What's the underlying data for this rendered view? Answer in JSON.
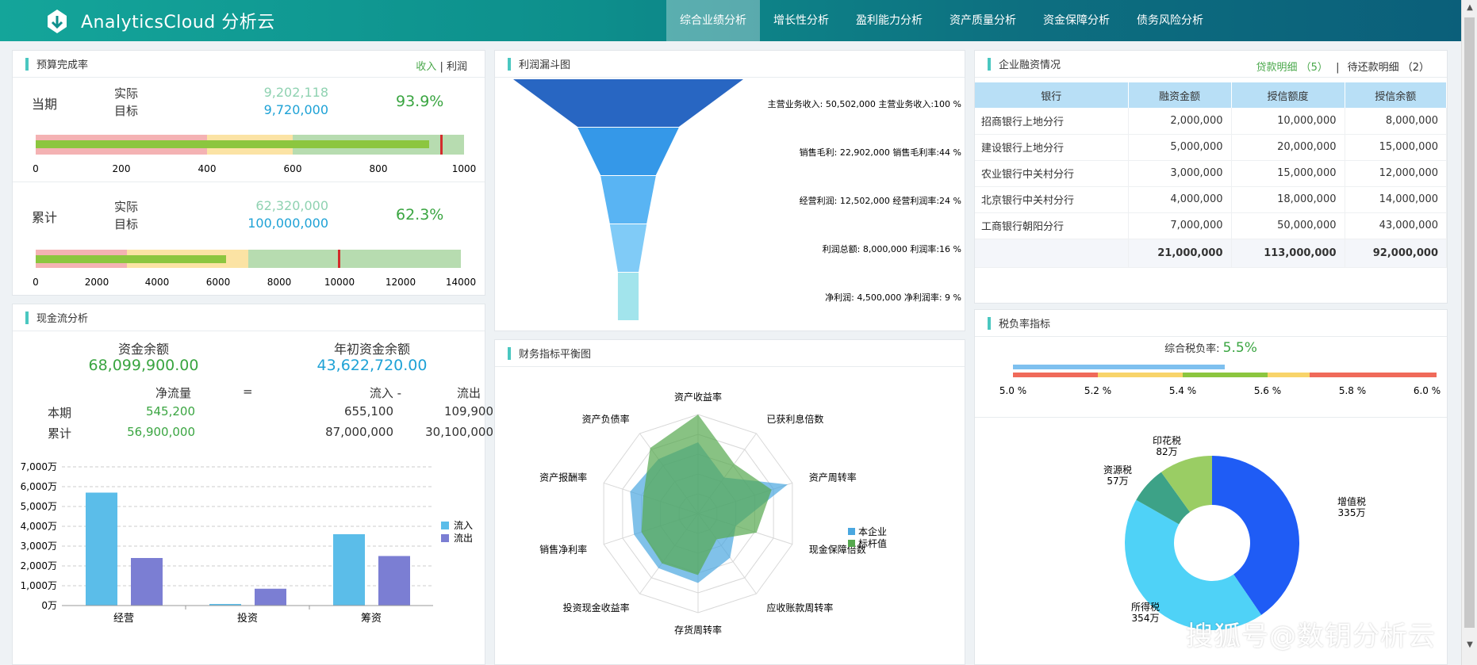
{
  "header": {
    "brand": "AnalyticsCloud 分析云",
    "nav": [
      "综合业绩分析",
      "增长性分析",
      "盈利能力分析",
      "资产质量分析",
      "资金保障分析",
      "债务风险分析"
    ]
  },
  "budget": {
    "title": "预算完成率",
    "toggle": {
      "income": "收入",
      "sep": "|",
      "profit": "利润"
    },
    "current": {
      "label": "当期",
      "actual_label": "实际",
      "target_label": "目标",
      "actual": "9,202,118",
      "target": "9,720,000",
      "rate": "93.9%",
      "ticks": [
        "0",
        "200",
        "400",
        "600",
        "800",
        "1000"
      ]
    },
    "cumulative": {
      "label": "累计",
      "actual_label": "实际",
      "target_label": "目标",
      "actual": "62,320,000",
      "target": "100,000,000",
      "rate": "62.3%",
      "ticks": [
        "0",
        "2000",
        "4000",
        "6000",
        "8000",
        "10000",
        "12000",
        "14000"
      ]
    }
  },
  "cashflow": {
    "title": "现金流分析",
    "balance_label": "资金余额",
    "balance": "68,099,900.00",
    "opening_label": "年初资金余额",
    "opening": "43,622,720.00",
    "col_net": "净流量",
    "eq": "=",
    "col_in": "流入 -",
    "col_out": "流出",
    "rows": [
      {
        "label": "本期",
        "net": "545,200",
        "in": "655,100",
        "out": "109,900"
      },
      {
        "label": "累计",
        "net": "56,900,000",
        "in": "87,000,000",
        "out": "30,100,000"
      }
    ],
    "chart_data": {
      "type": "bar",
      "categories": [
        "经营",
        "投资",
        "筹资"
      ],
      "series": [
        {
          "name": "流入",
          "values": [
            5700,
            80,
            3600
          ],
          "color": "#5bbde9"
        },
        {
          "name": "流出",
          "values": [
            2400,
            850,
            2500
          ],
          "color": "#7b7ed3"
        }
      ],
      "yticks": [
        "0万",
        "1,000万",
        "2,000万",
        "3,000万",
        "4,000万",
        "5,000万",
        "6,000万",
        "7,000万"
      ],
      "ylim": [
        0,
        7000
      ]
    }
  },
  "funnel": {
    "title": "利润漏斗图",
    "chart_data": {
      "type": "funnel",
      "stages": [
        {
          "label": "主营业务收入: 50,502,000 主营业务收入:100 %",
          "value": 100,
          "color": "#2866c2"
        },
        {
          "label": "销售毛利: 22,902,000 销售毛利率:44 %",
          "value": 44,
          "color": "#3598e8"
        },
        {
          "label": "经营利润: 12,502,000 经营利润率:24 %",
          "value": 24,
          "color": "#59b4f3"
        },
        {
          "label": "利润总额: 8,000,000 利润率:16 %",
          "value": 16,
          "color": "#80cbf7"
        },
        {
          "label": "净利润: 4,500,000 净利润率: 9 %",
          "value": 9,
          "color": "#a2e4ec"
        }
      ]
    }
  },
  "radar": {
    "title": "财务指标平衡图",
    "chart_data": {
      "type": "radar",
      "axes": [
        "资产收益率",
        "已获利息倍数",
        "资产周转率",
        "现金保障倍数",
        "应收账款周转率",
        "存货周转率",
        "投资现金收益率",
        "销售净利率",
        "资产报酬率",
        "资产负债率"
      ],
      "series": [
        {
          "name": "本企业",
          "values": [
            0.72,
            0.45,
            0.95,
            0.4,
            0.55,
            0.7,
            0.68,
            0.68,
            0.72,
            0.68
          ],
          "color": "#4aa7e0"
        },
        {
          "name": "标杆值",
          "values": [
            1.0,
            0.62,
            0.78,
            0.62,
            0.32,
            0.62,
            0.62,
            0.6,
            0.58,
            0.82
          ],
          "color": "#55a84e"
        }
      ]
    }
  },
  "financing": {
    "title": "企业融资情况",
    "loan_link": "贷款明细 （5）",
    "sep": "|",
    "repay_link": "待还款明细 （2）",
    "columns": [
      "银行",
      "融资金额",
      "授信额度",
      "授信余额"
    ],
    "rows": [
      [
        "招商银行上地分行",
        "2,000,000",
        "10,000,000",
        "8,000,000"
      ],
      [
        "建设银行上地分行",
        "5,000,000",
        "20,000,000",
        "15,000,000"
      ],
      [
        "农业银行中关村分行",
        "3,000,000",
        "15,000,000",
        "12,000,000"
      ],
      [
        "北京银行中关村分行",
        "4,000,000",
        "18,000,000",
        "14,000,000"
      ],
      [
        "工商银行朝阳分行",
        "7,000,000",
        "50,000,000",
        "43,000,000"
      ]
    ],
    "total": [
      "",
      "21,000,000",
      "113,000,000",
      "92,000,000"
    ]
  },
  "tax": {
    "title": "税负率指标",
    "rate_label": "综合税负率:",
    "rate": "5.5%",
    "rate_value": 5.5,
    "scale_min": 5.0,
    "scale_max": 6.0,
    "ticks": [
      "5.0 %",
      "5.2 %",
      "5.4 %",
      "5.6 %",
      "5.8 %",
      "6.0 %"
    ],
    "chart_data": {
      "type": "pie",
      "slices": [
        {
          "name": "增值税",
          "value_label": "335万",
          "value": 335,
          "color": "#1f5cf5"
        },
        {
          "name": "所得税",
          "value_label": "354万",
          "value": 354,
          "color": "#4fd2f7"
        },
        {
          "name": "资源税",
          "value_label": "57万",
          "value": 57,
          "color": "#3da287"
        },
        {
          "name": "印花税",
          "value_label": "82万",
          "value": 82,
          "color": "#9acd64"
        }
      ]
    }
  },
  "watermark": "搜狐号@数钥分析云"
}
